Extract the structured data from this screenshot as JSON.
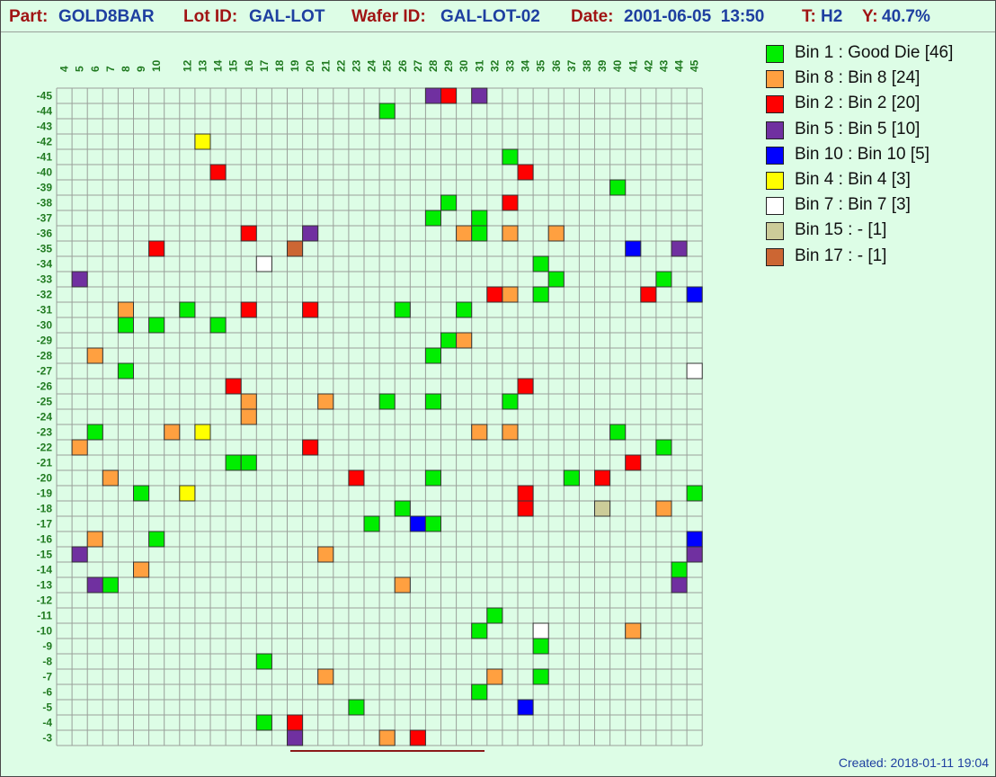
{
  "header": {
    "part_label": "Part:",
    "part_value": "GOLD8BAR",
    "lot_label": "Lot ID:",
    "lot_value": "GAL-LOT",
    "wafer_label": "Wafer ID:",
    "wafer_value": "GAL-LOT-02",
    "date_label": "Date:",
    "date_value": "2001-06-05  13:50",
    "t_label": "T:",
    "t_value": "H2",
    "y_label": "Y:",
    "y_value": "40.7%"
  },
  "footer": {
    "created": "Created: 2018-01-11 19:04"
  },
  "colors": {
    "background": "#ddfde6",
    "grid": "#9aa09a",
    "tick_label": "#207a20",
    "header_label": "#a01414",
    "header_value": "#1e3fa0",
    "underline": "#8b1a1a"
  },
  "legend": [
    {
      "key": "1",
      "label": "Bin 1 : Good Die [46]",
      "color": "#00ee00"
    },
    {
      "key": "8",
      "label": "Bin 8 : Bin 8 [24]",
      "color": "#ffa040"
    },
    {
      "key": "2",
      "label": "Bin 2 : Bin 2 [20]",
      "color": "#ff0000"
    },
    {
      "key": "5",
      "label": "Bin 5 : Bin 5 [10]",
      "color": "#7030a0"
    },
    {
      "key": "10",
      "label": "Bin 10 : Bin 10 [5]",
      "color": "#0000ff"
    },
    {
      "key": "4",
      "label": "Bin 4 : Bin 4 [3]",
      "color": "#ffff00"
    },
    {
      "key": "7",
      "label": "Bin 7 : Bin 7 [3]",
      "color": "#ffffff"
    },
    {
      "key": "15",
      "label": "Bin 15 : - [1]",
      "color": "#cccc99"
    },
    {
      "key": "17",
      "label": "Bin 17 : - [1]",
      "color": "#cc6633"
    }
  ],
  "chart_data": {
    "type": "heatmap",
    "x_ticks": [
      4,
      5,
      6,
      7,
      8,
      9,
      10,
      11,
      12,
      13,
      14,
      15,
      16,
      17,
      18,
      19,
      20,
      21,
      22,
      23,
      24,
      25,
      26,
      27,
      28,
      29,
      30,
      31,
      32,
      33,
      34,
      35,
      36,
      37,
      38,
      39,
      40,
      41,
      42,
      43,
      44,
      45
    ],
    "x_labels": [
      "4",
      "5",
      "6",
      "7",
      "8",
      "9",
      "10",
      "12",
      "13",
      "14",
      "15",
      "16",
      "17",
      "18",
      "19",
      "20",
      "21",
      "22",
      "23",
      "24",
      "25",
      "26",
      "27",
      "28",
      "29",
      "30",
      "31",
      "32",
      "33",
      "34",
      "35",
      "36",
      "37",
      "38",
      "39",
      "40",
      "41",
      "42",
      "43",
      "44",
      "45"
    ],
    "y_ticks": [
      -45,
      -44,
      -43,
      -42,
      -41,
      -40,
      -39,
      -38,
      -37,
      -36,
      -35,
      -34,
      -33,
      -32,
      -31,
      -30,
      -29,
      -28,
      -27,
      -26,
      -25,
      -24,
      -23,
      -22,
      -21,
      -20,
      -19,
      -18,
      -17,
      -16,
      -15,
      -14,
      -13,
      -12,
      -11,
      -10,
      -9,
      -8,
      -7,
      -6,
      -5,
      -4,
      -3
    ],
    "grid": true,
    "legend_position": "right",
    "dies": [
      [
        28,
        -45,
        "5"
      ],
      [
        29,
        -45,
        "2"
      ],
      [
        31,
        -45,
        "5"
      ],
      [
        25,
        -44,
        "1"
      ],
      [
        13,
        -42,
        "4"
      ],
      [
        33,
        -41,
        "1"
      ],
      [
        14,
        -40,
        "2"
      ],
      [
        34,
        -40,
        "2"
      ],
      [
        40,
        -39,
        "1"
      ],
      [
        29,
        -38,
        "1"
      ],
      [
        33,
        -38,
        "2"
      ],
      [
        28,
        -37,
        "1"
      ],
      [
        31,
        -37,
        "1"
      ],
      [
        16,
        -36,
        "2"
      ],
      [
        20,
        -36,
        "5"
      ],
      [
        30,
        -36,
        "8"
      ],
      [
        31,
        -36,
        "1"
      ],
      [
        33,
        -36,
        "8"
      ],
      [
        36,
        -36,
        "8"
      ],
      [
        10,
        -35,
        "2"
      ],
      [
        19,
        -35,
        "17"
      ],
      [
        41,
        -35,
        "10"
      ],
      [
        44,
        -35,
        "5"
      ],
      [
        17,
        -34,
        "7"
      ],
      [
        35,
        -34,
        "1"
      ],
      [
        5,
        -33,
        "5"
      ],
      [
        36,
        -33,
        "1"
      ],
      [
        43,
        -33,
        "1"
      ],
      [
        32,
        -32,
        "2"
      ],
      [
        33,
        -32,
        "8"
      ],
      [
        35,
        -32,
        "1"
      ],
      [
        42,
        -32,
        "2"
      ],
      [
        45,
        -32,
        "10"
      ],
      [
        8,
        -31,
        "8"
      ],
      [
        12,
        -31,
        "1"
      ],
      [
        16,
        -31,
        "2"
      ],
      [
        20,
        -31,
        "2"
      ],
      [
        26,
        -31,
        "1"
      ],
      [
        30,
        -31,
        "1"
      ],
      [
        8,
        -30,
        "1"
      ],
      [
        10,
        -30,
        "1"
      ],
      [
        14,
        -30,
        "1"
      ],
      [
        29,
        -29,
        "1"
      ],
      [
        30,
        -29,
        "8"
      ],
      [
        6,
        -28,
        "8"
      ],
      [
        28,
        -28,
        "1"
      ],
      [
        8,
        -27,
        "1"
      ],
      [
        45,
        -27,
        "7"
      ],
      [
        15,
        -26,
        "2"
      ],
      [
        34,
        -26,
        "2"
      ],
      [
        16,
        -25,
        "8"
      ],
      [
        21,
        -25,
        "8"
      ],
      [
        25,
        -25,
        "1"
      ],
      [
        28,
        -25,
        "1"
      ],
      [
        33,
        -25,
        "1"
      ],
      [
        16,
        -24,
        "8"
      ],
      [
        6,
        -23,
        "1"
      ],
      [
        11,
        -23,
        "8"
      ],
      [
        13,
        -23,
        "4"
      ],
      [
        31,
        -23,
        "8"
      ],
      [
        33,
        -23,
        "8"
      ],
      [
        40,
        -23,
        "1"
      ],
      [
        5,
        -22,
        "8"
      ],
      [
        20,
        -22,
        "2"
      ],
      [
        43,
        -22,
        "1"
      ],
      [
        15,
        -21,
        "1"
      ],
      [
        16,
        -21,
        "1"
      ],
      [
        41,
        -21,
        "2"
      ],
      [
        7,
        -20,
        "8"
      ],
      [
        23,
        -20,
        "2"
      ],
      [
        28,
        -20,
        "1"
      ],
      [
        37,
        -20,
        "1"
      ],
      [
        39,
        -20,
        "2"
      ],
      [
        9,
        -19,
        "1"
      ],
      [
        12,
        -19,
        "4"
      ],
      [
        34,
        -19,
        "2"
      ],
      [
        45,
        -19,
        "1"
      ],
      [
        26,
        -18,
        "1"
      ],
      [
        34,
        -18,
        "2"
      ],
      [
        39,
        -18,
        "15"
      ],
      [
        43,
        -18,
        "8"
      ],
      [
        24,
        -17,
        "1"
      ],
      [
        27,
        -17,
        "10"
      ],
      [
        28,
        -17,
        "1"
      ],
      [
        6,
        -16,
        "8"
      ],
      [
        10,
        -16,
        "1"
      ],
      [
        45,
        -16,
        "10"
      ],
      [
        5,
        -15,
        "5"
      ],
      [
        21,
        -15,
        "8"
      ],
      [
        45,
        -15,
        "5"
      ],
      [
        9,
        -14,
        "8"
      ],
      [
        44,
        -14,
        "1"
      ],
      [
        6,
        -13,
        "5"
      ],
      [
        7,
        -13,
        "1"
      ],
      [
        26,
        -13,
        "8"
      ],
      [
        44,
        -13,
        "5"
      ],
      [
        32,
        -11,
        "1"
      ],
      [
        31,
        -10,
        "1"
      ],
      [
        35,
        -10,
        "7"
      ],
      [
        41,
        -10,
        "8"
      ],
      [
        35,
        -9,
        "1"
      ],
      [
        17,
        -8,
        "1"
      ],
      [
        21,
        -7,
        "8"
      ],
      [
        32,
        -7,
        "8"
      ],
      [
        35,
        -7,
        "1"
      ],
      [
        31,
        -6,
        "1"
      ],
      [
        23,
        -5,
        "1"
      ],
      [
        34,
        -5,
        "10"
      ],
      [
        17,
        -4,
        "1"
      ],
      [
        19,
        -4,
        "2"
      ],
      [
        19,
        -3,
        "5"
      ],
      [
        25,
        -3,
        "8"
      ],
      [
        27,
        -3,
        "2"
      ]
    ]
  }
}
